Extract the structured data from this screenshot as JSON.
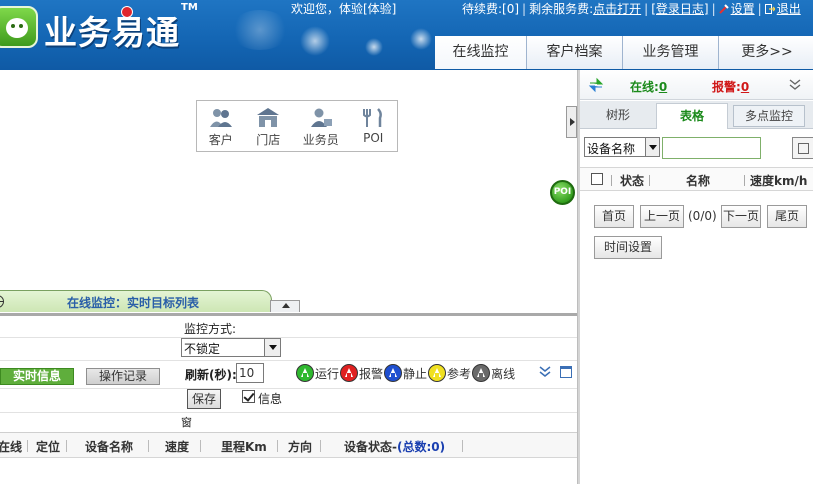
{
  "header": {
    "logo_text": "业务易通",
    "logo_tm": "TM",
    "welcome": "欢迎您，体验[体验]",
    "fee_text": "待续费:[0]",
    "remaining_label": "剩余服务费:",
    "remaining_link": "点击打开",
    "login_log": "[登录日志]",
    "settings": "设置",
    "logout": "退出"
  },
  "nav": {
    "tabs": [
      {
        "label": "在线监控"
      },
      {
        "label": "客户档案"
      },
      {
        "label": "业务管理"
      },
      {
        "label": "更多>>"
      }
    ]
  },
  "map": {
    "toolbar": [
      {
        "label": "客户",
        "icon": "customer-icon"
      },
      {
        "label": "门店",
        "icon": "store-icon"
      },
      {
        "label": "业务员",
        "icon": "salesman-icon"
      },
      {
        "label": "POI",
        "icon": "poi-icon"
      }
    ],
    "poi_badge": "POI"
  },
  "panel": {
    "tab_title": "在线监控：实时目标列表",
    "realtime_btn": "实时信息",
    "oplog_btn": "操作记录",
    "monitor_mode_label": "监控方式:",
    "monitor_mode_value": "不锁定",
    "refresh_label": "刷新(秒):",
    "refresh_value": "10",
    "save_btn": "保存",
    "info_label": "信息",
    "window_label": "窗",
    "legend": [
      {
        "label": "运行",
        "color": "#2fb82f"
      },
      {
        "label": "报警",
        "color": "#e02020"
      },
      {
        "label": "静止",
        "color": "#1f4fd0"
      },
      {
        "label": "参考",
        "color": "#f0e020"
      },
      {
        "label": "离线",
        "color": "#6a6a6a"
      }
    ],
    "columns": [
      "在线",
      "定位",
      "设备名称",
      "速度",
      "里程Km",
      "方向"
    ],
    "status_col_label": "设备状态-",
    "status_count": "(总数:0)"
  },
  "right": {
    "online_label": "在线:",
    "online_count": "0",
    "alarm_label": "报警:",
    "alarm_count": "0",
    "tabs": [
      {
        "label": "树形"
      },
      {
        "label": "表格"
      },
      {
        "label": "多点监控"
      }
    ],
    "search_field": "设备名称",
    "columns": [
      "状态",
      "名称",
      "速度km/h"
    ],
    "pager": {
      "first": "首页",
      "prev": "上一页",
      "info": "(0/0)",
      "next": "下一页",
      "last": "尾页",
      "time_settings": "时间设置"
    }
  }
}
